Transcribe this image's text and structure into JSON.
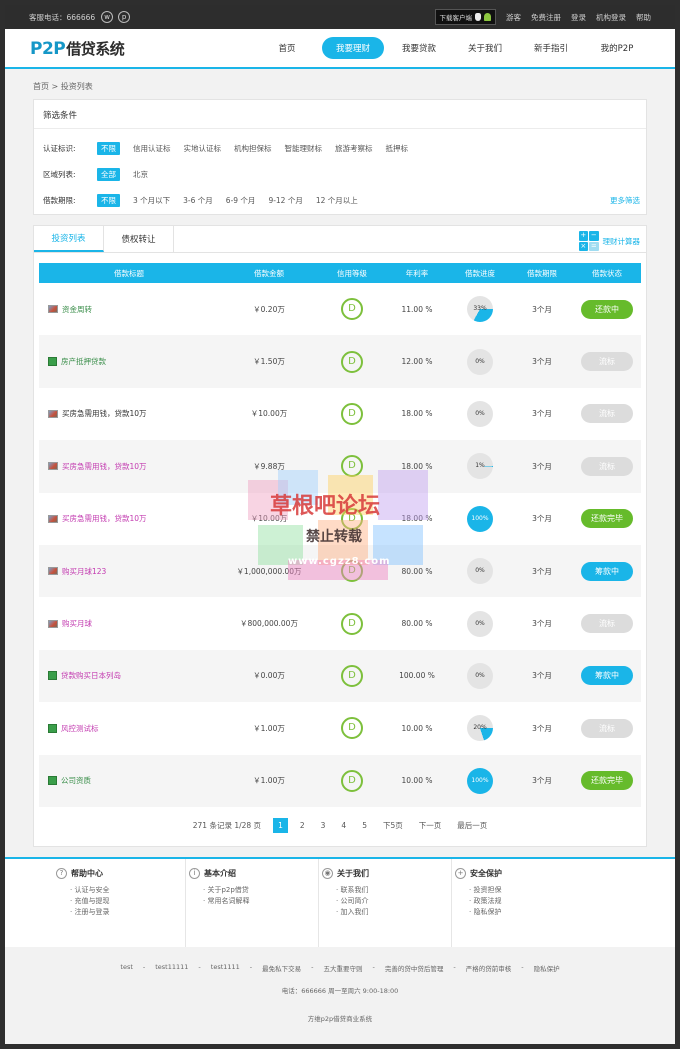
{
  "topbar": {
    "hotline": "客服电话：666666",
    "download": "下载客户端",
    "links": [
      "游客",
      "免费注册",
      "登录",
      "机构登录",
      "帮助"
    ]
  },
  "header": {
    "logo_main": "P2P",
    "logo_sub": "借贷系统",
    "nav": [
      "首页",
      "我要理财",
      "我要贷款",
      "关于我们",
      "新手指引",
      "我的P2P"
    ]
  },
  "breadcrumb": [
    "首页",
    "投资列表"
  ],
  "filter": {
    "title": "筛选条件",
    "rows": [
      {
        "label": "认证标识:",
        "options": [
          "不限",
          "信用认证标",
          "实地认证标",
          "机构担保标",
          "智能理财标",
          "旅游考察标",
          "抵押标"
        ]
      },
      {
        "label": "区域列表:",
        "options": [
          "全部",
          "北京"
        ]
      },
      {
        "label": "借款期限:",
        "options": [
          "不限",
          "3 个月以下",
          "3-6 个月",
          "6-9 个月",
          "9-12 个月",
          "12 个月以上"
        ]
      }
    ],
    "more": "更多筛选"
  },
  "tabs": [
    "投资列表",
    "债权转让"
  ],
  "calculator": {
    "label": "理财计算器",
    "icon": "calculator-icon"
  },
  "table": {
    "headers": [
      "借款标题",
      "借款金额",
      "信用等级",
      "年利率",
      "借款进度",
      "借款期限",
      "借款状态"
    ],
    "rows": [
      {
        "icon": "image",
        "color": "green",
        "title": "资金周转",
        "amount": "￥0.20万",
        "grade": "D",
        "rate": "11.00 %",
        "progress": "33%",
        "pct": 33,
        "term": "3个月",
        "status": "还款中",
        "status_type": "green"
      },
      {
        "icon": "guarantee",
        "color": "green",
        "title": "房产抵押贷款",
        "amount": "￥1.50万",
        "grade": "D",
        "rate": "12.00 %",
        "progress": "0%",
        "pct": 0,
        "term": "3个月",
        "status": "流标",
        "status_type": "grey"
      },
      {
        "icon": "image",
        "color": "dark",
        "title": "买房急需用钱，贷款10万",
        "amount": "￥10.00万",
        "grade": "D",
        "rate": "18.00 %",
        "progress": "0%",
        "pct": 0,
        "term": "3个月",
        "status": "流标",
        "status_type": "grey"
      },
      {
        "icon": "image",
        "color": "pink",
        "title": "买房急需用钱，贷款10万",
        "amount": "￥9.88万",
        "grade": "D",
        "rate": "18.00 %",
        "progress": "1%",
        "pct": 1,
        "term": "3个月",
        "status": "流标",
        "status_type": "grey"
      },
      {
        "icon": "image",
        "color": "pink",
        "title": "买房急需用钱，贷款10万",
        "amount": "￥10.00万",
        "grade": "D",
        "rate": "18.00 %",
        "progress": "100%",
        "pct": 100,
        "term": "3个月",
        "status": "还款完毕",
        "status_type": "green"
      },
      {
        "icon": "image",
        "color": "pink",
        "title": "购买月球123",
        "amount": "￥1,000,000.00万",
        "grade": "D",
        "rate": "80.00 %",
        "progress": "0%",
        "pct": 0,
        "term": "3个月",
        "status": "筹款中",
        "status_type": "blue"
      },
      {
        "icon": "image",
        "color": "pink",
        "title": "购买月球",
        "amount": "￥800,000.00万",
        "grade": "D",
        "rate": "80.00 %",
        "progress": "0%",
        "pct": 0,
        "term": "3个月",
        "status": "流标",
        "status_type": "grey"
      },
      {
        "icon": "guarantee",
        "color": "pink",
        "title": "贷款购买日本列岛",
        "amount": "￥0.00万",
        "grade": "D",
        "rate": "100.00 %",
        "progress": "0%",
        "pct": 0,
        "term": "3个月",
        "status": "筹款中",
        "status_type": "blue"
      },
      {
        "icon": "credit",
        "color": "pink",
        "title": "风控测试标",
        "amount": "￥1.00万",
        "grade": "D",
        "rate": "10.00 %",
        "progress": "20%",
        "pct": 20,
        "term": "3个月",
        "status": "流标",
        "status_type": "grey"
      },
      {
        "icon": "guarantee",
        "color": "green",
        "title": "公司资质",
        "amount": "￥1.00万",
        "grade": "D",
        "rate": "10.00 %",
        "progress": "100%",
        "pct": 100,
        "term": "3个月",
        "status": "还款完毕",
        "status_type": "green"
      }
    ]
  },
  "pager": {
    "summary": "271 条记录 1/28 页",
    "pages": [
      "1",
      "2",
      "3",
      "4",
      "5"
    ],
    "current": "1",
    "next5": "下5页",
    "next": "下一页",
    "last": "最后一页"
  },
  "watermark": {
    "line1": "草根吧论坛",
    "line2": "禁止转载",
    "line3": "www.cgzz8.com"
  },
  "footer": {
    "columns": [
      {
        "title": "帮助中心",
        "icon": "question-icon",
        "items": [
          "认证与安全",
          "充值与提现",
          "注册与登录"
        ]
      },
      {
        "title": "基本介绍",
        "icon": "info-icon",
        "items": [
          "关于p2p借贷",
          "常用名词解释"
        ]
      },
      {
        "title": "关于我们",
        "icon": "about-icon",
        "items": [
          "联系我们",
          "公司简介",
          "加入我们"
        ]
      },
      {
        "title": "安全保护",
        "icon": "shield-icon",
        "items": [
          "投资担保",
          "政策法规",
          "隐私保护"
        ]
      }
    ],
    "links": [
      "test",
      "-",
      "test11111",
      "-",
      "test1111",
      "-",
      "最免私下交易",
      "-",
      "五大重要守则",
      "-",
      "完善的贷中贷后管理",
      "-",
      "严格的贷前审核",
      "-",
      "隐私保护"
    ],
    "contact": "电话：666666  周一至周六 9:00-18:00",
    "copyright": "方维p2p借贷商业系统"
  },
  "colors": {
    "accent": "#1ab5e8",
    "green": "#66bb2b",
    "grade": "#7dc03c"
  }
}
